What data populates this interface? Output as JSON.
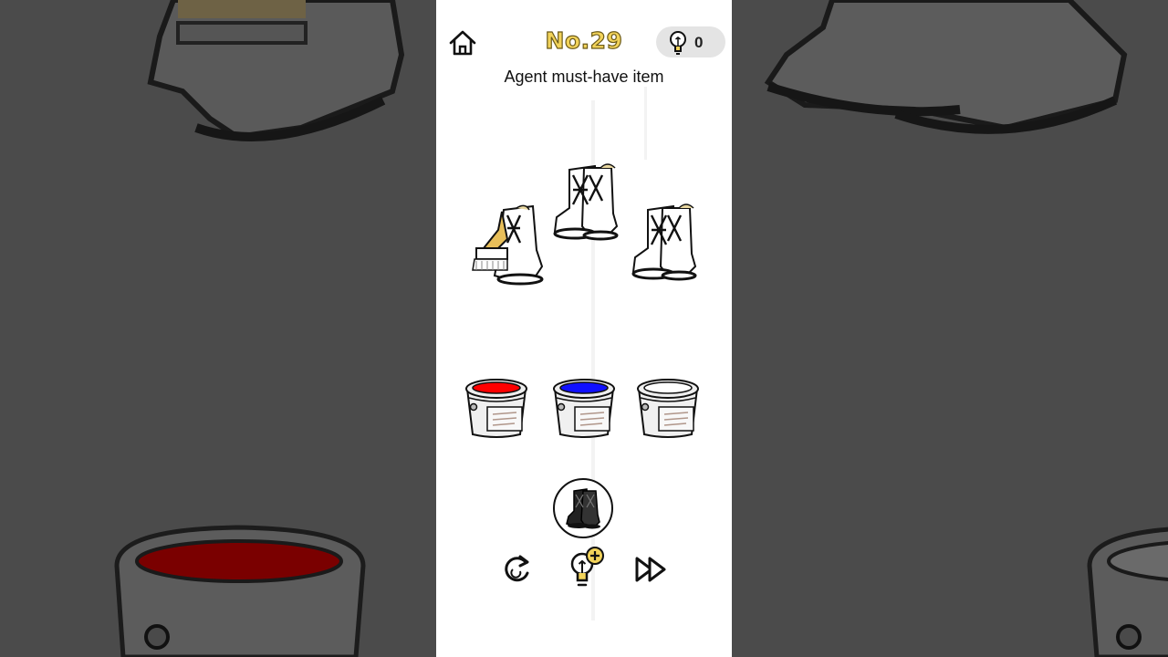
{
  "header": {
    "home_icon": "home-icon",
    "level_label": "No.29",
    "hint_icon": "lightbulb-icon",
    "hint_count": "0"
  },
  "puzzle": {
    "prompt": "Agent must-have item",
    "boots": [
      {
        "id": "boot-with-brush",
        "icon": "boots-with-paintbrush-icon"
      },
      {
        "id": "boot-center",
        "icon": "white-boots-icon"
      },
      {
        "id": "boot-right",
        "icon": "white-boots-icon"
      }
    ],
    "paint_buckets": [
      {
        "id": "bucket-red",
        "color": "#ff0000"
      },
      {
        "id": "bucket-blue",
        "color": "#1010ff"
      },
      {
        "id": "bucket-white",
        "color": "#ffffff"
      }
    ],
    "target_item": {
      "icon": "black-boots-icon"
    }
  },
  "controls": {
    "restart_icon": "restart-icon",
    "hint_add_icon": "lightbulb-plus-icon",
    "skip_icon": "skip-forward-icon"
  },
  "colors": {
    "level_fill": "#f2d35a",
    "background": "#4a4a4a",
    "panel": "#ffffff"
  }
}
